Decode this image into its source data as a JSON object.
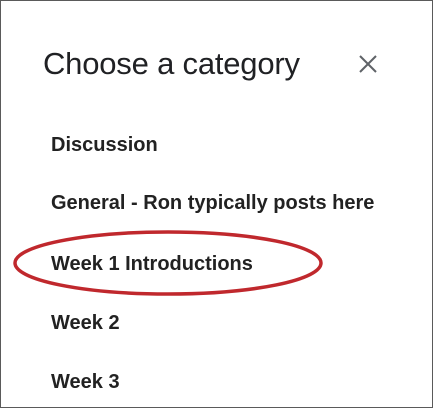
{
  "dialog": {
    "title": "Choose a category",
    "close_icon": "close-icon"
  },
  "categories": [
    {
      "label": "Discussion"
    },
    {
      "label": "General - Ron typically posts here"
    },
    {
      "label": "Week 1 Introductions",
      "highlighted": true
    },
    {
      "label": "Week 2"
    },
    {
      "label": "Week 3"
    }
  ],
  "colors": {
    "highlight_ring": "#c0282d",
    "text": "#222222",
    "border": "#5a5a5a"
  }
}
